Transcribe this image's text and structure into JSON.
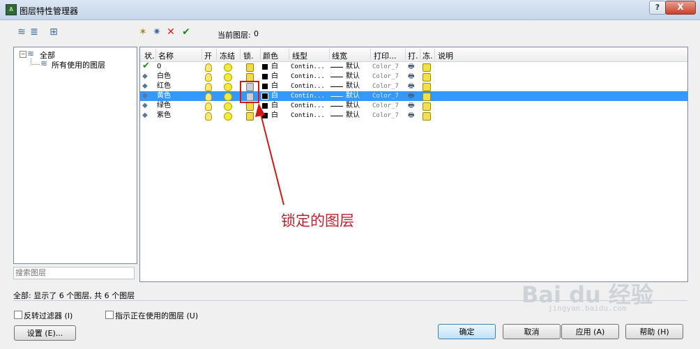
{
  "window": {
    "title": "图层特性管理器",
    "help_label": "?",
    "close_label": "X"
  },
  "toolbar": {
    "current_layer_label": "当前图层:",
    "current_layer_value": "0"
  },
  "tree": {
    "root_label": "全部",
    "child_label": "所有使用的图层"
  },
  "search": {
    "placeholder": "搜索图层"
  },
  "columns": {
    "status": "状.",
    "name": "名称",
    "on": "开",
    "freeze": "冻结",
    "lock": "锁.",
    "color": "颜色",
    "linetype": "线型",
    "lineweight": "线宽",
    "plotstyle": "打印...",
    "plot": "打.",
    "newvpfreeze": "冻.",
    "description": "说明"
  },
  "layers": [
    {
      "name": "0",
      "color": "白",
      "linetype": "Contin...",
      "lineweight": "默认",
      "plotstyle": "Color_7",
      "locked": false,
      "current": true
    },
    {
      "name": "白色",
      "color": "白",
      "linetype": "Contin...",
      "lineweight": "默认",
      "plotstyle": "Color_7",
      "locked": false,
      "current": false
    },
    {
      "name": "红色",
      "color": "白",
      "linetype": "Contin...",
      "lineweight": "默认",
      "plotstyle": "Color_7",
      "locked": true,
      "current": false
    },
    {
      "name": "黄色",
      "color": "白",
      "linetype": "Contin...",
      "lineweight": "默认",
      "plotstyle": "Color_7",
      "locked": true,
      "current": false
    },
    {
      "name": "绿色",
      "color": "白",
      "linetype": "Contin...",
      "lineweight": "默认",
      "plotstyle": "Color_7",
      "locked": false,
      "current": false
    },
    {
      "name": "紫色",
      "color": "白",
      "linetype": "Contin...",
      "lineweight": "默认",
      "plotstyle": "Color_7",
      "locked": false,
      "current": false
    }
  ],
  "selected_layer_index": 3,
  "annotation": "锁定的图层",
  "status": {
    "summary": "全部: 显示了 6 个图层, 共 6 个图层"
  },
  "options": {
    "invert_filter": "反转过滤器 (I)",
    "indicate_used": "指示正在使用的图层 (U)"
  },
  "buttons": {
    "settings": "设置 (E)...",
    "ok": "确定",
    "cancel": "取消",
    "apply": "应用 (A)",
    "help": "帮助 (H)"
  },
  "watermark": {
    "brand": "Bai du 经验",
    "url": "jingyan.baidu.com"
  },
  "colors": {
    "selection": "#3399ff",
    "annotation": "#b8232f",
    "highlight_box": "#d01818"
  }
}
